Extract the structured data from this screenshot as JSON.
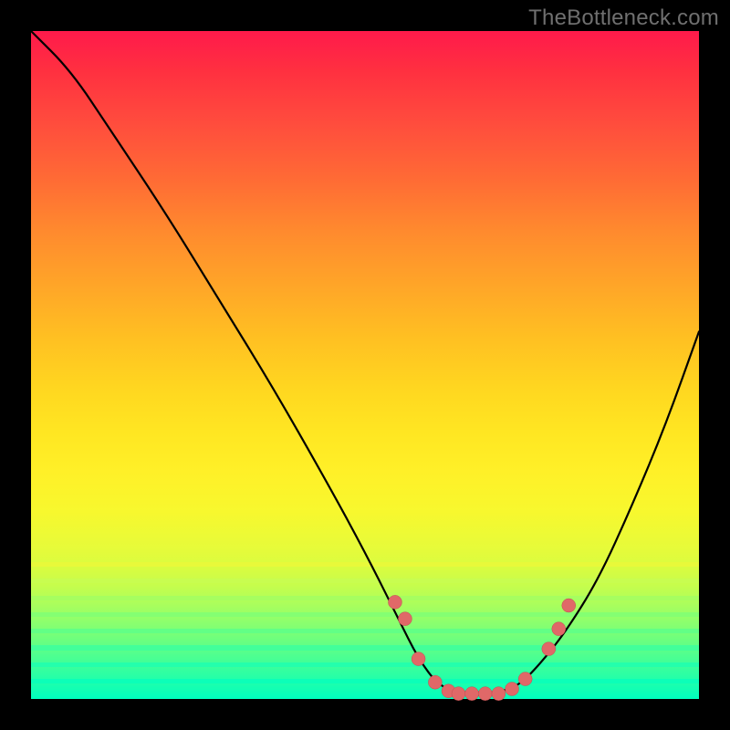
{
  "watermark": "TheBottleneck.com",
  "colors": {
    "frame": "#000000",
    "curve_stroke": "#000000",
    "marker_fill": "#e06868",
    "marker_stroke": "#c05050",
    "watermark_text": "#6f6f6f"
  },
  "chart_data": {
    "type": "line",
    "title": "",
    "xlabel": "",
    "ylabel": "",
    "xlim": [
      0,
      100
    ],
    "ylim": [
      0,
      100
    ],
    "grid": false,
    "legend": false,
    "series": [
      {
        "name": "bottleneck-curve",
        "x": [
          0,
          6,
          12,
          20,
          28,
          36,
          44,
          50,
          55,
          58,
          61,
          64,
          67,
          70,
          73,
          76,
          80,
          85,
          90,
          95,
          100
        ],
        "y": [
          100,
          94,
          85,
          73,
          60,
          47,
          33,
          22,
          12,
          6,
          2,
          1,
          1,
          1,
          2,
          5,
          10,
          18,
          29,
          41,
          55
        ]
      }
    ],
    "markers": {
      "name": "highlighted-points",
      "x": [
        54.5,
        56.0,
        58.0,
        60.5,
        62.5,
        64.0,
        66.0,
        68.0,
        70.0,
        72.0,
        74.0,
        77.5,
        79.0,
        80.5
      ],
      "y": [
        14.5,
        12.0,
        6.0,
        2.5,
        1.2,
        0.8,
        0.8,
        0.8,
        0.8,
        1.5,
        3.0,
        7.5,
        10.5,
        14.0
      ]
    }
  }
}
